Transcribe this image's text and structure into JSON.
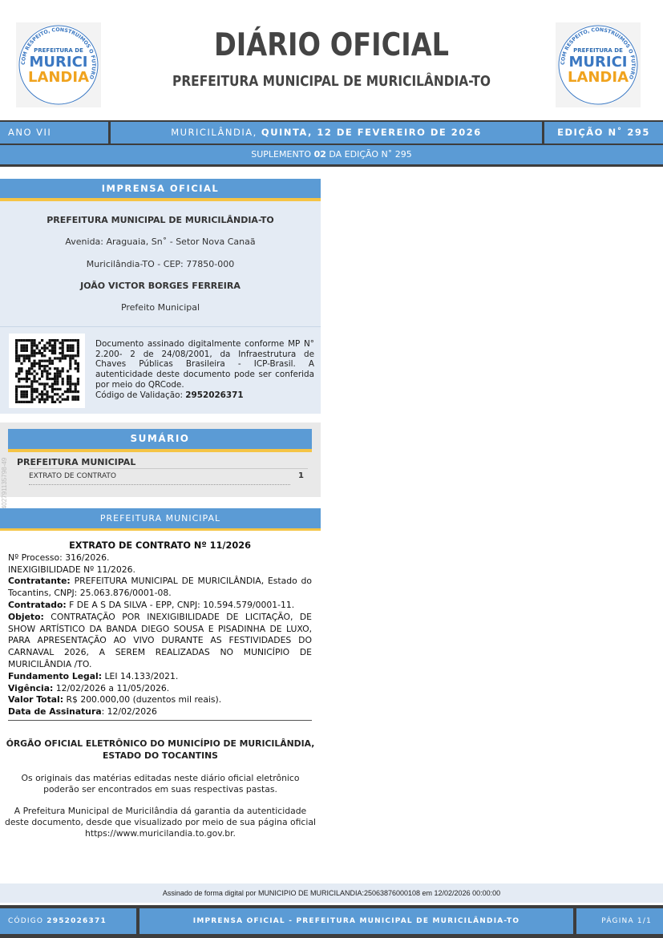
{
  "header": {
    "title": "DIÁRIO OFICIAL",
    "subtitle": "PREFEITURA MUNICIPAL DE MURICILÂNDIA-TO",
    "logo_text": "PREFEITURA DE MURICI LÂNDIA",
    "logo_ring_text": "COM RESPEITO, CONSTRUIMOS O FUTURO"
  },
  "edition_bar": {
    "year": "ANO VII",
    "city": "MURICILÂNDIA,",
    "date": "QUINTA, 12 DE FEVEREIRO DE 2026",
    "edition": "EDIÇÃO N˚ 295"
  },
  "supplement": {
    "prefix": "SUPLEMENTO",
    "number": "02",
    "suffix": "DA EDIÇÃO N˚ 295"
  },
  "imprensa": {
    "heading": "IMPRENSA OFICIAL",
    "entity": "PREFEITURA MUNICIPAL DE MURICILÂNDIA-TO",
    "address": "Avenida: Araguaia, Sn˚ - Setor Nova Canaã",
    "city_cep": "Muricilândia-TO - CEP: 77850-000",
    "mayor_name": "JOÃO VICTOR BORGES FERREIRA",
    "mayor_title": "Prefeito Municipal",
    "signature_text": "Documento assinado digitalmente conforme MP N° 2.200- 2 de 24/08/2001, da Infraestrutura de Chaves Públicas Brasileira - ICP-Brasil. A autenticidade deste documento pode ser conferida por meio do QRCode.",
    "validation_label": "Código de Validação:",
    "validation_code": "2952026371"
  },
  "summary": {
    "heading": "SUMÁRIO",
    "category": "PREFEITURA MUNICIPAL",
    "item_label": "EXTRATO DE CONTRATO",
    "item_page": "1"
  },
  "side_code": "7560402791135798-49",
  "section_heading": "PREFEITURA MUNICIPAL",
  "contract": {
    "title": "EXTRATO DE CONTRATO Nº 11/2026",
    "processo": "Nº Processo: 316/2026.",
    "inexigibilidade": "INEXIGIBILIDADE Nº 11/2026.",
    "contratante_label": "Contratante:",
    "contratante": "PREFEITURA MUNICIPAL DE MURICILÂNDIA, Estado do Tocantins, CNPJ: 25.063.876/0001-08.",
    "contratado_label": "Contratado:",
    "contratado": "F DE A S DA SILVA - EPP, CNPJ: 10.594.579/0001-11.",
    "objeto_label": "Objeto:",
    "objeto": "CONTRATAÇÃO POR INEXIGIBILIDADE DE LICITAÇÃO, DE SHOW ARTÍSTICO DA BANDA DIEGO SOUSA E PISADINHA DE LUXO, PARA APRESENTAÇÃO AO VIVO DURANTE AS FESTIVIDADES DO CARNAVAL 2026, A SEREM REALIZADAS NO MUNICÍPIO DE MURICILÂNDIA /TO.",
    "fundamento_label": "Fundamento Legal:",
    "fundamento": "LEI 14.133/2021.",
    "vigencia_label": "Vigência:",
    "vigencia": "12/02/2026 a 11/05/2026.",
    "valor_label": "Valor Total:",
    "valor": "R$ 200.000,00 (duzentos mil reais).",
    "assinatura_label": "Data de Assinatura",
    "assinatura": ": 12/02/2026"
  },
  "orgao": {
    "title": "ÓRGÃO OFICIAL ELETRÔNICO DO MUNICÍPIO DE MURICILÂNDIA, ESTADO DO TOCANTINS",
    "p1": "Os originais das matérias editadas neste diário oficial eletrônico poderão ser encontrados em suas respectivas pastas.",
    "p2": "A Prefeitura Municipal de Muricilândia dá garantia da autenticidade deste documento, desde que visualizado por meio de sua página oficial https://www.muricilandia.to.gov.br."
  },
  "footer": {
    "signed_by": "Assinado de forma digital por MUNICIPIO DE MURICILANDIA:25063876000108 em 12/02/2026 00:00:00",
    "code_label": "CÓDIGO",
    "code": "2952026371",
    "center": "IMPRENSA OFICIAL - PREFEITURA MUNICIPAL DE MURICILÂNDIA-TO",
    "page": "PÁGINA 1/1"
  },
  "colors": {
    "bar_blue": "#5b9bd5",
    "accent_yellow": "#f5c445",
    "dark": "#3d3d3d"
  }
}
